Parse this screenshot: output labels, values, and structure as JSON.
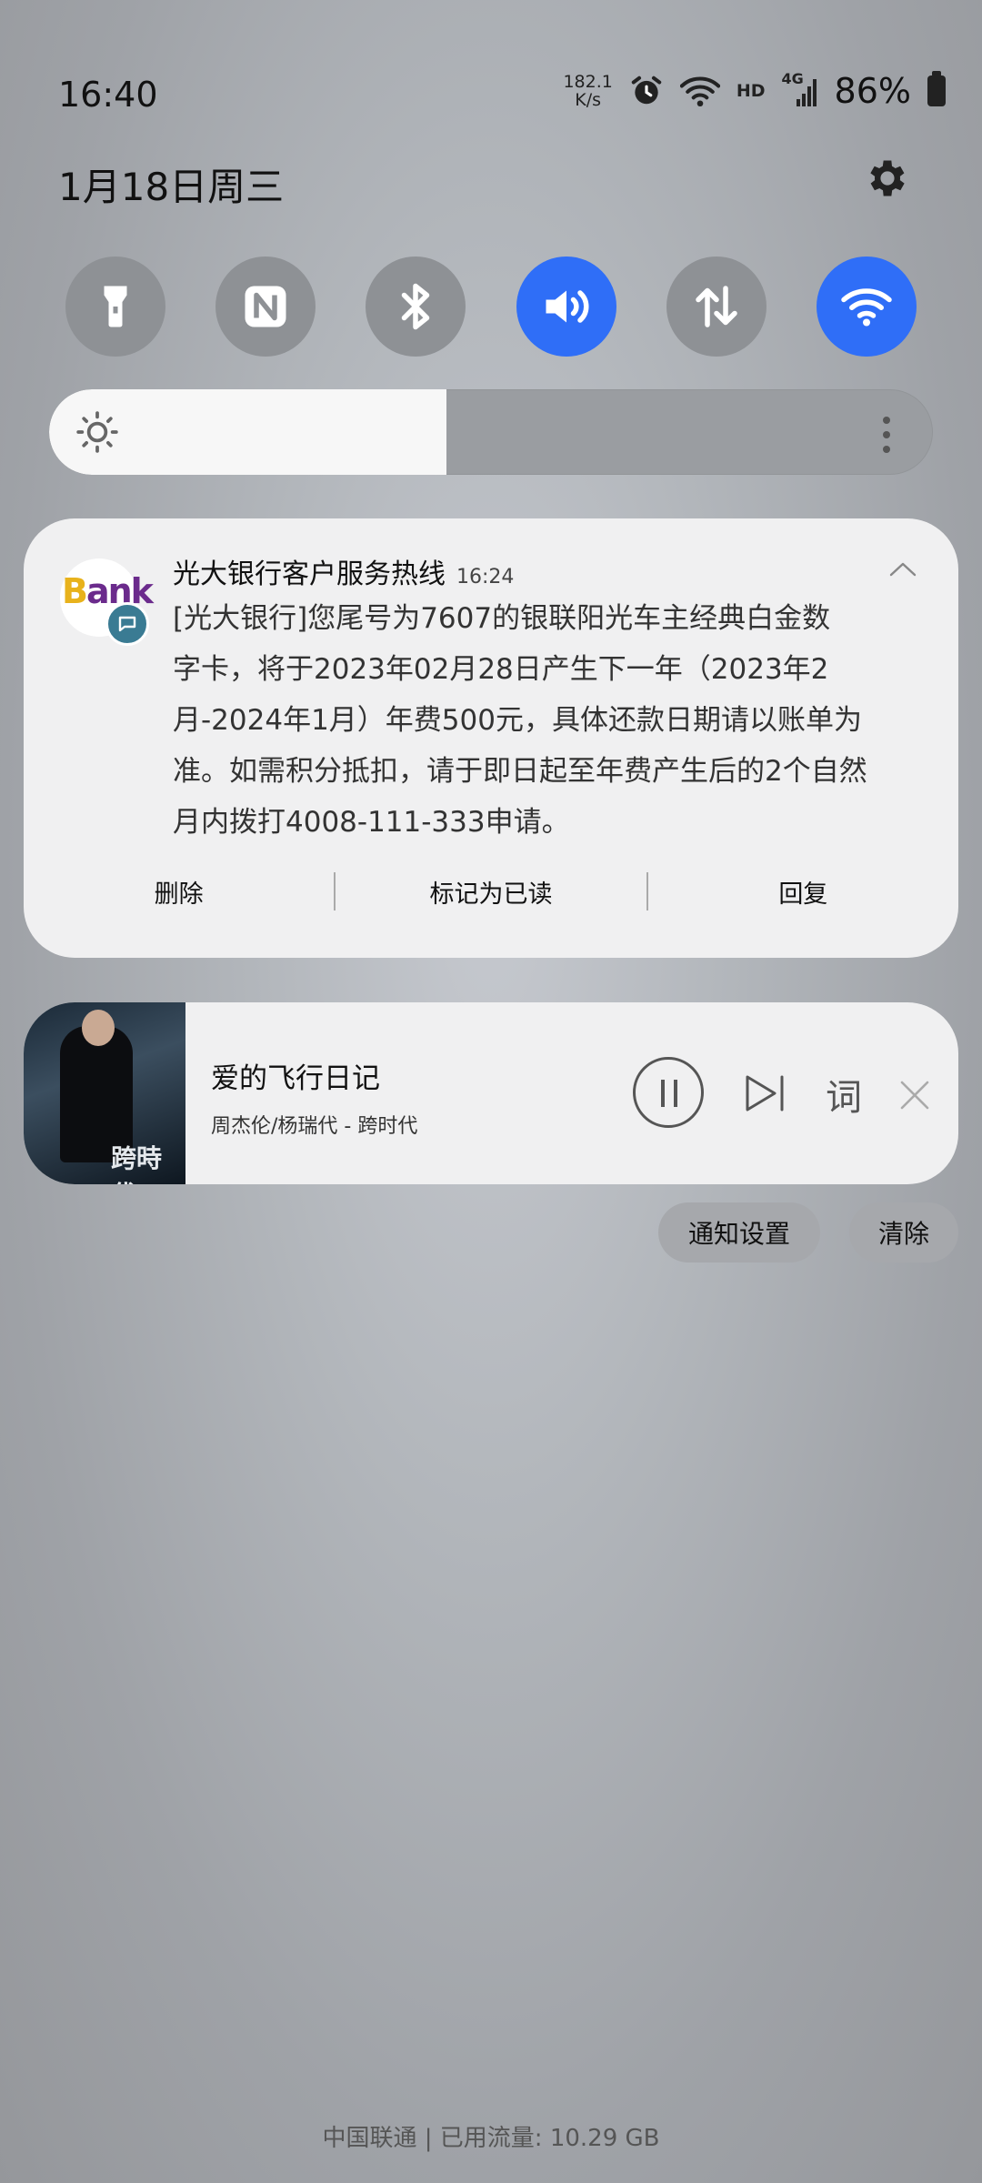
{
  "status_bar": {
    "time": "16:40",
    "net_speed_value": "182.1",
    "net_speed_unit": "K/s",
    "hd_label": "HD",
    "network_label": "4G",
    "battery_percent": "86%",
    "icons": [
      "alarm-icon",
      "wifi-icon",
      "signal-icon",
      "battery-icon"
    ]
  },
  "date": "1月18日周三",
  "quick_toggles": [
    {
      "name": "flashlight",
      "icon": "flashlight-icon",
      "on": false
    },
    {
      "name": "nfc",
      "icon": "nfc-icon",
      "on": false
    },
    {
      "name": "bluetooth",
      "icon": "bluetooth-icon",
      "on": false
    },
    {
      "name": "sound",
      "icon": "volume-icon",
      "on": true
    },
    {
      "name": "mobile-data",
      "icon": "data-arrows-icon",
      "on": false
    },
    {
      "name": "wifi",
      "icon": "wifi-icon",
      "on": true
    }
  ],
  "brightness": {
    "level": 0.45
  },
  "notification": {
    "app_title": "光大银行客户服务热线",
    "time": "16:24",
    "body_lines": [
      "[光大银行]您尾号为7607的银联阳光车主经典白金数",
      "字卡，将于2023年02月28日产生下一年（2023年2",
      "月-2024年1月）年费500元，具体还款日期请以账单为",
      "准。如需积分抵扣，请于即日起至年费产生后的2个自然",
      "月内拨打4008-111-333申请。"
    ],
    "icon_text_first": "B",
    "icon_text_rest": "ank",
    "actions": {
      "delete": "删除",
      "mark_read": "标记为已读",
      "reply": "回复"
    }
  },
  "media": {
    "song": "爱的飞行日记",
    "artist": "周杰伦/杨瑞代 - 跨时代",
    "cover_text": "跨時代",
    "lyric_label": "词"
  },
  "buttons": {
    "notification_settings": "通知设置",
    "clear": "清除"
  },
  "carrier_info": "中国联通 | 已用流量: 10.29 GB",
  "colors": {
    "accent": "#2f6ef7",
    "toggle_off": "#8e9195",
    "card_bg": "#f0f0f1"
  }
}
